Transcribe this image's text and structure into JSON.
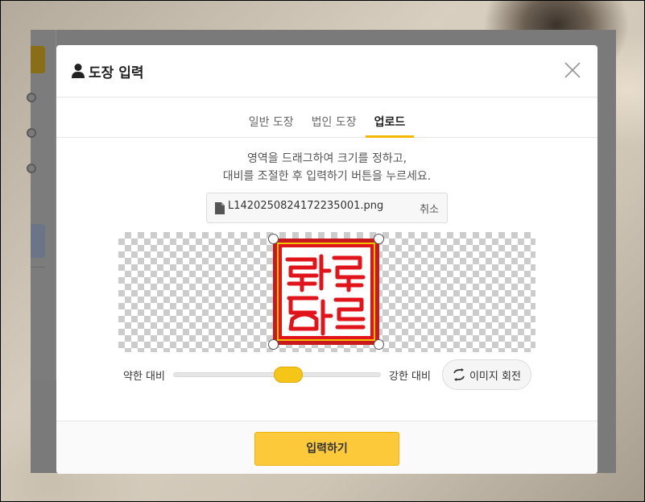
{
  "modal": {
    "title": "도장 입력",
    "title_icon": "person-icon",
    "close_icon": "close-icon"
  },
  "tabs": [
    {
      "label": "일반 도장",
      "active": false
    },
    {
      "label": "법인 도장",
      "active": false
    },
    {
      "label": "업로드",
      "active": true
    }
  ],
  "instruction": {
    "line1": "영역을 드래그하여 크기를 정하고,",
    "line2": "대비를 조절한 후 입력하기 버튼을 누르세요."
  },
  "file": {
    "icon": "file-icon",
    "name": "L1420250824172235001.png",
    "cancel_label": "취소"
  },
  "contrast": {
    "weak_label": "약한 대비",
    "strong_label": "강한 대비",
    "value": 0.5
  },
  "rotate": {
    "icon": "rotate-icon",
    "label": "이미지 회전"
  },
  "footer": {
    "submit_label": "입력하기"
  },
  "colors": {
    "accent": "#fcc93a",
    "stamp_red": "#e0141a",
    "stamp_gold": "#f2c200"
  }
}
